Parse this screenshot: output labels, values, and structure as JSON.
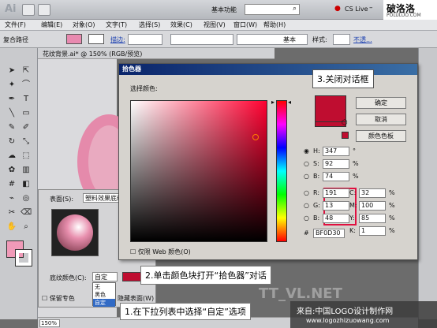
{
  "app": {
    "logo": "Ai",
    "workspace": "基本功能",
    "cs_live": "CS Live",
    "corner_brand": "破洛洛",
    "corner_url": "POLULUO.COM"
  },
  "menu": [
    "文件(F)",
    "编辑(E)",
    "对象(O)",
    "文字(T)",
    "选择(S)",
    "效果(C)",
    "视图(V)",
    "窗口(W)",
    "帮助(H)"
  ],
  "control_bar": {
    "label": "复合路径",
    "stroke_label": "描边:",
    "preset": "基本",
    "style_label": "样式:",
    "opacity": "不透..."
  },
  "doc_tab": "花纹背景.ai* @ 150% (RGB/预览)",
  "picker": {
    "title": "拾色器",
    "select_color": "选择颜色:",
    "ok": "确定",
    "cancel": "取消",
    "swatches": "颜色色板",
    "hsb": [
      {
        "label": "H:",
        "value": "347",
        "unit": "°"
      },
      {
        "label": "S:",
        "value": "92",
        "unit": "%"
      },
      {
        "label": "B:",
        "value": "74",
        "unit": "%"
      }
    ],
    "rgb": [
      {
        "label": "R:",
        "value": "191"
      },
      {
        "label": "G:",
        "value": "13"
      },
      {
        "label": "B:",
        "value": "48"
      }
    ],
    "cmyk": [
      {
        "label": "C:",
        "value": "32",
        "unit": "%"
      },
      {
        "label": "M:",
        "value": "100",
        "unit": "%"
      },
      {
        "label": "Y:",
        "value": "85",
        "unit": "%"
      },
      {
        "label": "K:",
        "value": "1",
        "unit": "%"
      }
    ],
    "hex_label": "#",
    "hex": "BF0D30",
    "web_only": "仅限 Web 颜色(O)",
    "selected_color": "#bf0d30"
  },
  "fill_panel": {
    "surface": "表面(S):",
    "surface_value": "塑料效果底纹",
    "shade_label": "底纹颜色(C):",
    "shade_value": "自定",
    "options": [
      "无",
      "黑色",
      "自定"
    ],
    "preserve": "保留专色",
    "hidden": "隐藏表面(W)"
  },
  "callouts": {
    "c1": "1.在下拉列表中选择“自定”选项",
    "c2": "2.单击颜色块打开“拾色器”对话",
    "c3": "3.关闭对话框"
  },
  "status": {
    "zoom": "150%"
  },
  "watermark": {
    "line1": "来自:中国LOGO设计制作网",
    "line2": "www.logozhizuowang.com",
    "bg_text": "TT_VL.NET"
  }
}
